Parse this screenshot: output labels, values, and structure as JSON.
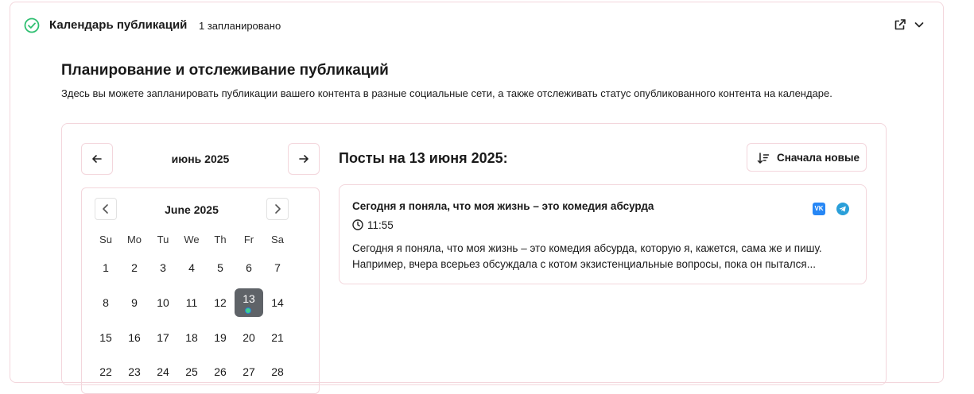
{
  "header": {
    "title": "Календарь публикаций",
    "scheduled_count": "1 запланировано"
  },
  "intro": {
    "title": "Планирование и отслеживание публикаций",
    "description": "Здесь вы можете запланировать публикации вашего контента в разные социальные сети, а также отслеживать статус опубликованного контента на календаре."
  },
  "month_nav": {
    "label": "июнь 2025"
  },
  "calendar": {
    "title": "June 2025",
    "weekdays": [
      "Su",
      "Mo",
      "Tu",
      "We",
      "Th",
      "Fr",
      "Sa"
    ],
    "weeks": [
      [
        "1",
        "2",
        "3",
        "4",
        "5",
        "6",
        "7"
      ],
      [
        "8",
        "9",
        "10",
        "11",
        "12",
        "13",
        "14"
      ],
      [
        "15",
        "16",
        "17",
        "18",
        "19",
        "20",
        "21"
      ],
      [
        "22",
        "23",
        "24",
        "25",
        "26",
        "27",
        "28"
      ]
    ],
    "selected_day": "13",
    "days_with_posts": [
      "13"
    ]
  },
  "posts": {
    "heading": "Посты на 13 июня 2025:",
    "sort_label": "Сначала новые",
    "items": [
      {
        "title": "Сегодня я поняла, что моя жизнь – это комедия абсурда",
        "time": "11:55",
        "text": "Сегодня я поняла, что моя жизнь – это комедия абсурда, которую я, кажется, сама же и пишу. Например, вчера всерьез обсуждала с котом экзистенциальные вопросы, пока он пытался...",
        "networks": [
          "vk",
          "telegram"
        ],
        "vk_label": "VK"
      }
    ]
  },
  "colors": {
    "border": "#f3d6dc",
    "check_green": "#2fbf71",
    "selected_day_bg": "#5f6368",
    "vk_blue": "#2787f5",
    "telegram_blue": "#2a9fd9"
  }
}
